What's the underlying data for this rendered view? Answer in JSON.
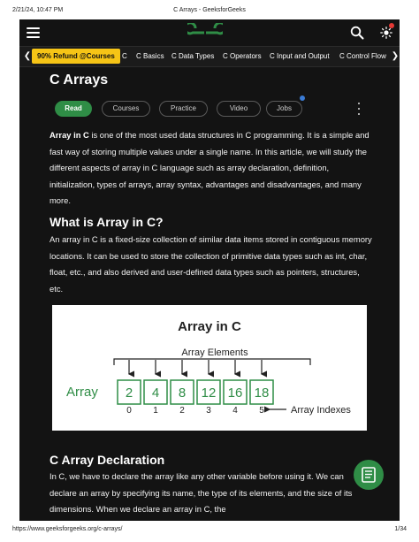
{
  "print_header": {
    "datetime": "2/21/24, 10:47 PM",
    "doc_title": "C Arrays - GeeksforGeeks"
  },
  "print_footer": {
    "url": "https://www.geeksforgeeks.org/c-arrays/",
    "page": "1/34"
  },
  "topbar": {
    "logo_text": "GG",
    "icons": [
      "menu-icon",
      "search-icon",
      "theme-toggle-icon"
    ]
  },
  "nav": {
    "items": [
      "90% Refund @Courses",
      "C",
      "C Basics",
      "C Data Types",
      "C Operators",
      "C Input and Output",
      "C Control Flow"
    ]
  },
  "article": {
    "title": "C Arrays",
    "tabs": [
      "Read",
      "Courses",
      "Practice",
      "Video",
      "Jobs"
    ],
    "intro_bold": "Array in C",
    "intro_rest": " is one of the most used data structures in C programming. It is a simple and fast way of storing multiple values under a single name. In this article, we will study the different aspects of array in C language such as array declaration, definition, initialization, types of arrays, array syntax, advantages and disadvantages, and many more.",
    "h2_what": "What is Array in C?",
    "para_what": "An array in C is a fixed-size collection of similar data items stored in contiguous memory locations. It can be used to store the collection of primitive data types such as int, char, float, etc., and also derived and user-defined data types such as pointers, structures, etc.",
    "h2_decl": "C Array Declaration",
    "para_decl": "In C, we have to declare the array like any other variable before using it. We can declare an array by specifying its name, the type of its elements, and the size of its dimensions. When we declare an array in C, the"
  },
  "diagram": {
    "title": "Array in C",
    "elements_label": "Array Elements",
    "array_label": "Array",
    "values": [
      "2",
      "4",
      "8",
      "12",
      "16",
      "18"
    ],
    "indexes": [
      "0",
      "1",
      "2",
      "3",
      "4",
      "5"
    ],
    "indexes_label": "Array Indexes",
    "colors": {
      "green": "#2f8d46",
      "ink": "#222222"
    }
  },
  "colors": {
    "brand_green": "#2f8d46",
    "refund_yellow": "#f6c416",
    "page_bg": "#131313"
  }
}
